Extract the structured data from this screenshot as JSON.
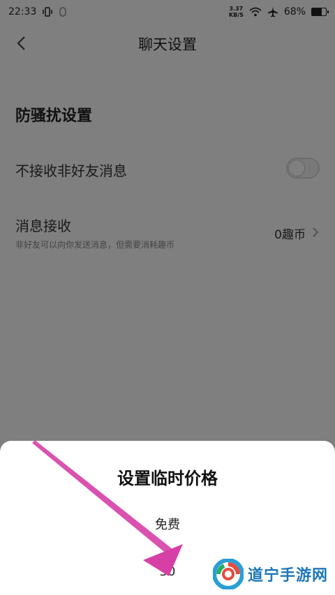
{
  "status_bar": {
    "time": "22:33",
    "speed_value": "3.37",
    "speed_unit": "KB/S",
    "battery": "68%",
    "battery_level": 0.68
  },
  "header": {
    "title": "聊天设置"
  },
  "section": {
    "title": "防骚扰设置"
  },
  "settings": {
    "no_stranger_label": "不接收非好友消息",
    "no_stranger_enabled": false,
    "message_receive_label": "消息接收",
    "message_receive_sub": "非好友可以向你发送消息，但需要消耗趣币",
    "message_receive_value": "0趣币"
  },
  "sheet": {
    "title": "设置临时价格",
    "options": [
      "免费",
      "30"
    ]
  },
  "watermark": {
    "text": "道宁手游网"
  },
  "colors": {
    "arrow": "#d63fa6",
    "watermark": "#1e76b8"
  }
}
